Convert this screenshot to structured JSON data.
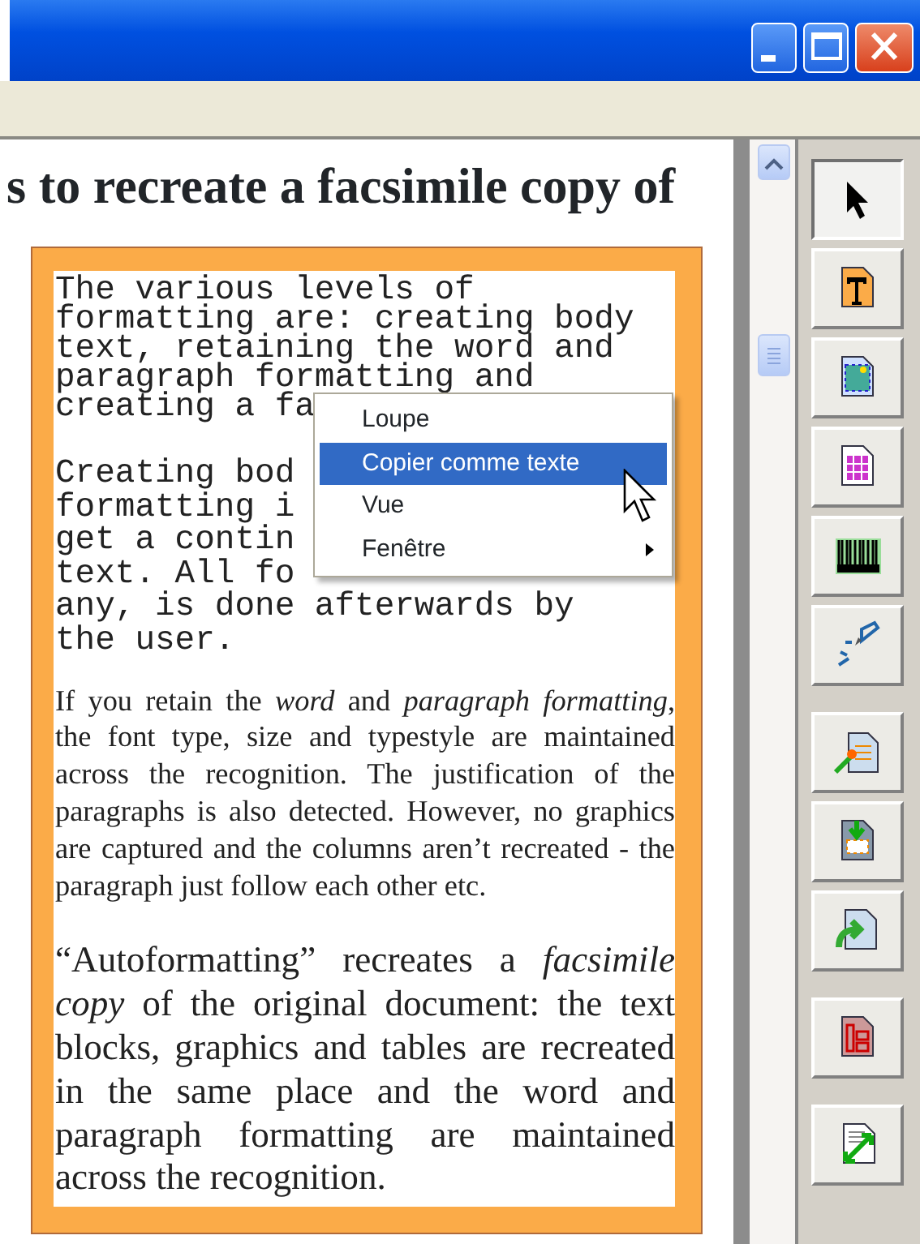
{
  "document": {
    "heading": "s to recreate a facsimile copy of",
    "paragraphs": [
      {
        "kind": "mono",
        "lines": [
          "The various levels of",
          "formatting are: creating body",
          "text, retaining the word and",
          "paragraph formatting and",
          "creating a fa"
        ]
      },
      {
        "kind": "mono",
        "lines": [
          "Creating bod",
          "formatting i",
          "get a contin",
          "text. All fo",
          "any, is done afterwards by",
          "the user."
        ]
      },
      {
        "kind": "serif",
        "text": "If you retain the *word* and *paragraph formatting*, the font type, size and typestyle are maintained across the recognition. The justification of the paragraphs is also detected. However, no graphics are captured and the columns aren’t recreated - the paragraph just follow each other etc."
      },
      {
        "kind": "serif_large",
        "text": "“Autoformatting” recreates a *facsimile copy* of the original document: the text blocks, graphics and tables are recreated in the same place and the word and paragraph formatting are maintained across the recognition."
      }
    ]
  },
  "context_menu": {
    "items": [
      {
        "label": "Loupe",
        "selected": false,
        "submenu": false
      },
      {
        "label": "Copier comme texte",
        "selected": true,
        "submenu": false
      },
      {
        "label": "Vue",
        "selected": false,
        "submenu": false
      },
      {
        "label": "Fenêtre",
        "selected": false,
        "submenu": true
      }
    ]
  },
  "toolbar": {
    "groups": [
      {
        "tools": [
          {
            "kind": "pointer",
            "selected": true
          },
          {
            "kind": "text",
            "selected": false
          },
          {
            "kind": "picture",
            "selected": false
          },
          {
            "kind": "table",
            "selected": false
          },
          {
            "kind": "barcode",
            "selected": false
          },
          {
            "kind": "handwriting",
            "selected": false
          }
        ]
      },
      {
        "tools": [
          {
            "kind": "wand",
            "selected": false
          },
          {
            "kind": "import",
            "selected": false
          },
          {
            "kind": "export",
            "selected": false
          }
        ]
      },
      {
        "tools": [
          {
            "kind": "layout",
            "selected": false
          }
        ]
      },
      {
        "tools": [
          {
            "kind": "fit",
            "selected": false
          }
        ]
      }
    ]
  }
}
